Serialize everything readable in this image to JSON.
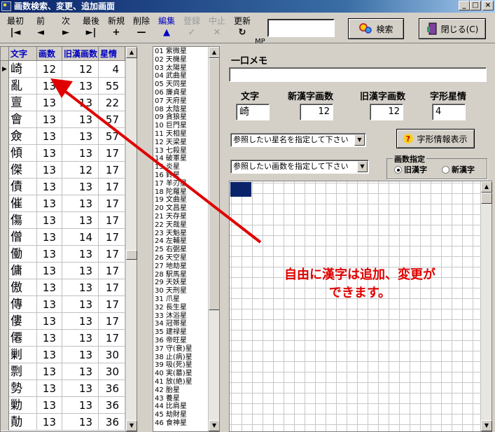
{
  "window": {
    "title": "画数検索、変更、追加画面",
    "icon": "app-kanji-icon",
    "controls": [
      "_",
      "□",
      "×"
    ]
  },
  "toolbar": {
    "buttons": [
      {
        "label": "最初",
        "icon": "|◄",
        "state": "normal"
      },
      {
        "label": "前",
        "icon": "◄",
        "state": "normal"
      },
      {
        "label": "次",
        "icon": "►",
        "state": "normal"
      },
      {
        "label": "最後",
        "icon": "►|",
        "state": "normal"
      },
      {
        "label": "新規",
        "icon": "+",
        "state": "normal"
      },
      {
        "label": "削除",
        "icon": "—",
        "state": "normal"
      },
      {
        "label": "編集",
        "icon": "▲",
        "state": "active"
      },
      {
        "label": "登録",
        "icon": "✓",
        "state": "disabled"
      },
      {
        "label": "中止",
        "icon": "✕",
        "state": "disabled"
      },
      {
        "label": "更新",
        "icon": "↻",
        "state": "normal"
      }
    ],
    "mp_label": "MP",
    "mp_value": "",
    "search_label": "検索",
    "close_label": "閉じる(C)"
  },
  "grid": {
    "headers": [
      "文字",
      "画数",
      "旧漢画数",
      "星情"
    ],
    "rows": [
      [
        "崎",
        "12",
        "12",
        "4"
      ],
      [
        "亂",
        "13",
        "13",
        "55"
      ],
      [
        "亶",
        "13",
        "13",
        "22"
      ],
      [
        "會",
        "13",
        "13",
        "57"
      ],
      [
        "僉",
        "13",
        "13",
        "57"
      ],
      [
        "傾",
        "13",
        "13",
        "17"
      ],
      [
        "傑",
        "13",
        "12",
        "17"
      ],
      [
        "債",
        "13",
        "13",
        "17"
      ],
      [
        "催",
        "13",
        "13",
        "17"
      ],
      [
        "傷",
        "13",
        "13",
        "17"
      ],
      [
        "僧",
        "13",
        "14",
        "17"
      ],
      [
        "働",
        "13",
        "13",
        "17"
      ],
      [
        "傭",
        "13",
        "13",
        "17"
      ],
      [
        "傲",
        "13",
        "13",
        "17"
      ],
      [
        "傳",
        "13",
        "13",
        "17"
      ],
      [
        "僂",
        "13",
        "13",
        "17"
      ],
      [
        "僊",
        "13",
        "13",
        "17"
      ],
      [
        "剿",
        "13",
        "13",
        "30"
      ],
      [
        "剽",
        "13",
        "13",
        "30"
      ],
      [
        "勢",
        "13",
        "13",
        "36"
      ],
      [
        "勦",
        "13",
        "13",
        "36"
      ],
      [
        "勣",
        "13",
        "13",
        "36"
      ]
    ],
    "current_row": 0
  },
  "stars": [
    "01 紫微星",
    "02 天機星",
    "03 太陽星",
    "04 武曲星",
    "05 天同星",
    "06 廉貞星",
    "07 天府星",
    "08 太陰星",
    "09 貪狼星",
    "10 巨門星",
    "11 天相星",
    "12 天梁星",
    "13 七殺星",
    "14 破軍星",
    "15 炎星",
    "16 鈴星",
    "17 羊刃星",
    "18 陀羅星",
    "19 文曲星",
    "20 文昌星",
    "21 天存星",
    "22 天哉星",
    "23 天魁星",
    "24 左輔星",
    "25 右弼星",
    "26 天空星",
    "27 地劫星",
    "28 駅馬星",
    "29 天妖星",
    "30 天刑星",
    "31 爪星",
    "32 長生星",
    "33 沐浴星",
    "34 冠帯星",
    "35 建禄星",
    "36 帝旺星",
    "37 守(衰)星",
    "38 止(病)星",
    "39 吸(死)星",
    "40 実(墓)星",
    "41 放(絶)星",
    "42 胎星",
    "43 養星",
    "44 比肩星",
    "45 劫財星",
    "46 食神星"
  ],
  "right": {
    "memo_label": "一口メモ",
    "memo_value": "",
    "char_label": "文字",
    "new_count_label": "新漢字画数",
    "old_count_label": "旧漢字画数",
    "star_label": "字形星情",
    "char_value": "崎",
    "new_count_value": "12",
    "old_count_value": "12",
    "star_value": "4",
    "star_combo": "参照したい星名を指定して下さい",
    "count_combo": "参照したい画数を指定して下さい",
    "info_button": "字形情報表示",
    "group_title": "画数指定",
    "radio_old": "旧漢字",
    "radio_new": "新漢字",
    "radio_selected": "old"
  },
  "annotation": {
    "line1": "自由に漢字は追加、変更が",
    "line2": "できます。",
    "color": "#e00000"
  }
}
